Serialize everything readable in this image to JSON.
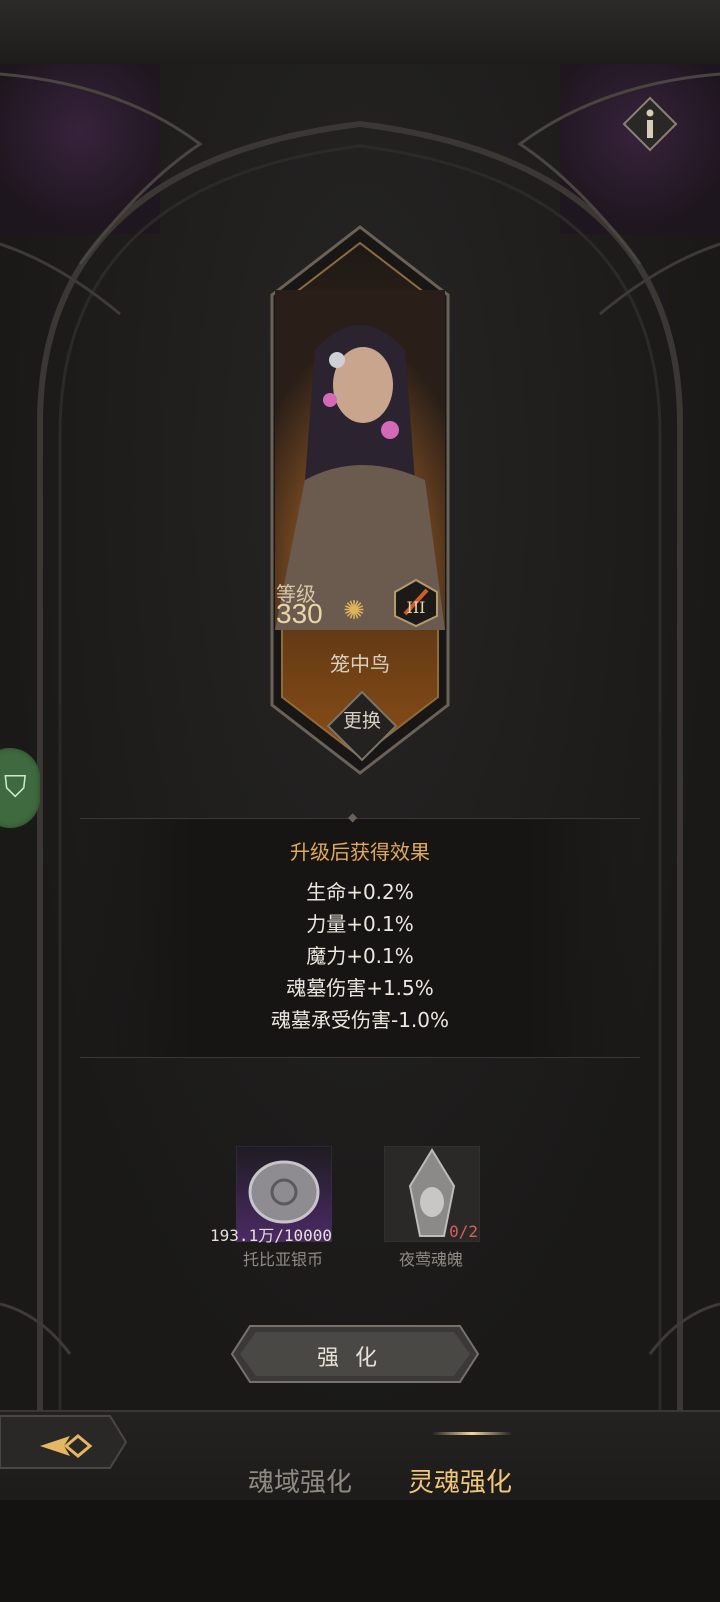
{
  "character": {
    "level_label": "等级",
    "level_value": "330",
    "name": "笼中鸟",
    "change_label": "更换",
    "rank": "III"
  },
  "effects": {
    "title": "升级后获得效果",
    "lines": [
      "生命+0.2%",
      "力量+0.1%",
      "魔力+0.1%",
      "魂墓伤害+1.5%",
      "魂墓承受伤害-1.0%"
    ]
  },
  "materials": [
    {
      "count": "193.1万/10000",
      "name": "托比亚银币",
      "count_color": "#e6e0d6"
    },
    {
      "count": "0/2",
      "name": "夜莺魂魄",
      "count_color": "#d65f5f"
    }
  ],
  "upgrade_label": "强化",
  "tabs": [
    {
      "label": "魂域强化",
      "active": false
    },
    {
      "label": "灵魂强化",
      "active": true
    }
  ],
  "colors": {
    "accent": "#e1a95c",
    "active_tab": "#f0c77a",
    "inactive_tab": "#8f8a82",
    "shortage": "#d65f5f"
  }
}
